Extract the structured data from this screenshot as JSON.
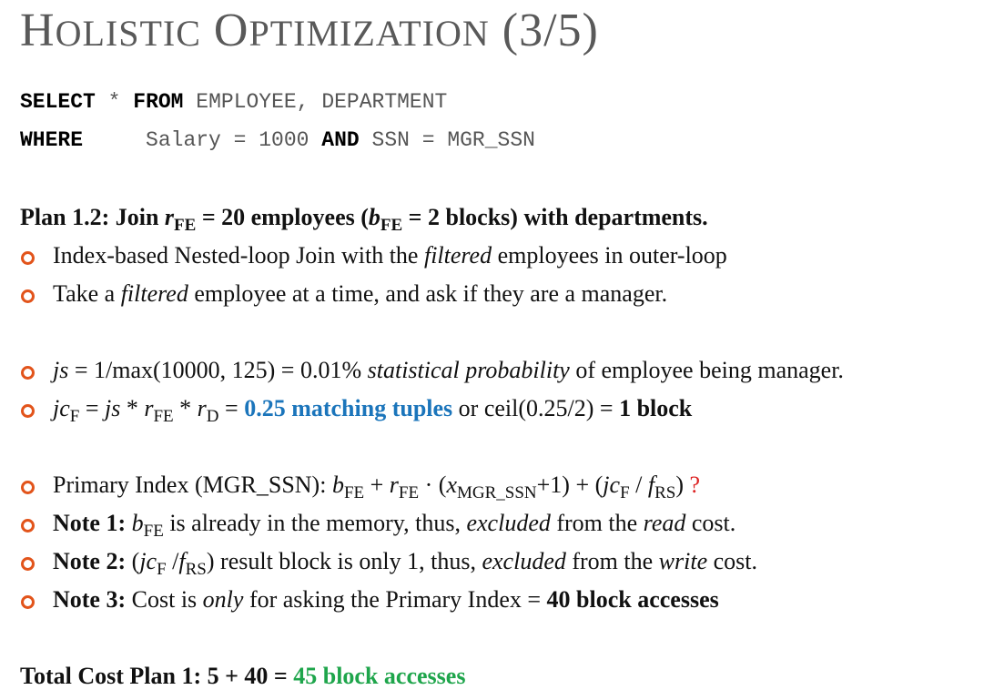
{
  "slide": {
    "title": {
      "H": "H",
      "olistic": "OLISTIC",
      "O": "O",
      "ptimization": "PTIMIZATION",
      "counter": "(3/5)"
    },
    "sql": {
      "select_kw": "SELECT",
      "star": "*",
      "from_kw": "FROM",
      "tables": "EMPLOYEE, DEPARTMENT",
      "where_kw": "WHERE",
      "cond1": "Salary = 1000",
      "and_kw": "AND",
      "cond2": "SSN = MGR_SSN"
    },
    "plan_heading": {
      "a": "Plan 1.2: Join ",
      "r": "r",
      "r_sub": "FE",
      "b": " = 20 employees (",
      "bv": "b",
      "bv_sub": "FE",
      "c": " = 2 blocks) with departments."
    },
    "bullet1": {
      "a": "Index-based Nested-loop Join with the ",
      "em": "filtered",
      "b": " employees in outer-loop"
    },
    "bullet2": {
      "a": "Take a ",
      "em": "filtered",
      "b": " employee at a time, and ask if they are a manager."
    },
    "bullet3": {
      "js": "js",
      "a": " = 1/max(10000, 125) = 0.01% ",
      "em": "statistical probability",
      "b": " of employee being manager."
    },
    "bullet4": {
      "jc": "jc",
      "jc_sub": "F",
      "eq": " = ",
      "js": "js",
      "star1": " * ",
      "r1": "r",
      "r1_sub": "FE",
      "star2": " * ",
      "r2": "r",
      "r2_sub": "D",
      "eq2": " = ",
      "blue": "0.25 matching tuples",
      "or": " or ceil(0.25/2) = ",
      "bold": "1 block"
    },
    "bullet5": {
      "a": "Primary Index (MGR_SSN): ",
      "b": "b",
      "b_sub": "FE",
      "plus": " + ",
      "r": "r",
      "r_sub": "FE",
      "dot": " · (",
      "x": "x",
      "x_sub": "MGR_SSN",
      "c": "+1) + (",
      "jc": "jc",
      "jc_sub": "F",
      "slash": " / ",
      "f": "f",
      "f_sub": "RS",
      "close": ")",
      "q": " ?"
    },
    "note1": {
      "label": "Note 1:",
      "b": " b",
      "b_sub": "FE",
      "a": " is already in the memory, thus, ",
      "em1": "excluded",
      "c": " from the ",
      "em2": "read",
      "d": " cost."
    },
    "note2": {
      "label": "Note 2:",
      "a": " (",
      "jc": "jc",
      "jc_sub": "F",
      "slash": " /",
      "f": "f",
      "f_sub": "RS",
      "b": ") result block is only 1, thus, ",
      "em1": "excluded",
      "c": " from the ",
      "em2": "write",
      "d": " cost."
    },
    "note3": {
      "label": "Note 3:",
      "a": " Cost is ",
      "em": "only",
      "b": " for asking the Primary Index = ",
      "bold": "40 block accesses"
    },
    "total": {
      "a": "Total Cost Plan 1: 5 + 40 = ",
      "green": "45 block accesses"
    }
  },
  "colors": {
    "bullet": "#e2541b",
    "blue": "#1b75bb",
    "green": "#1ea54b",
    "red": "#dd2222",
    "title": "#595959"
  }
}
